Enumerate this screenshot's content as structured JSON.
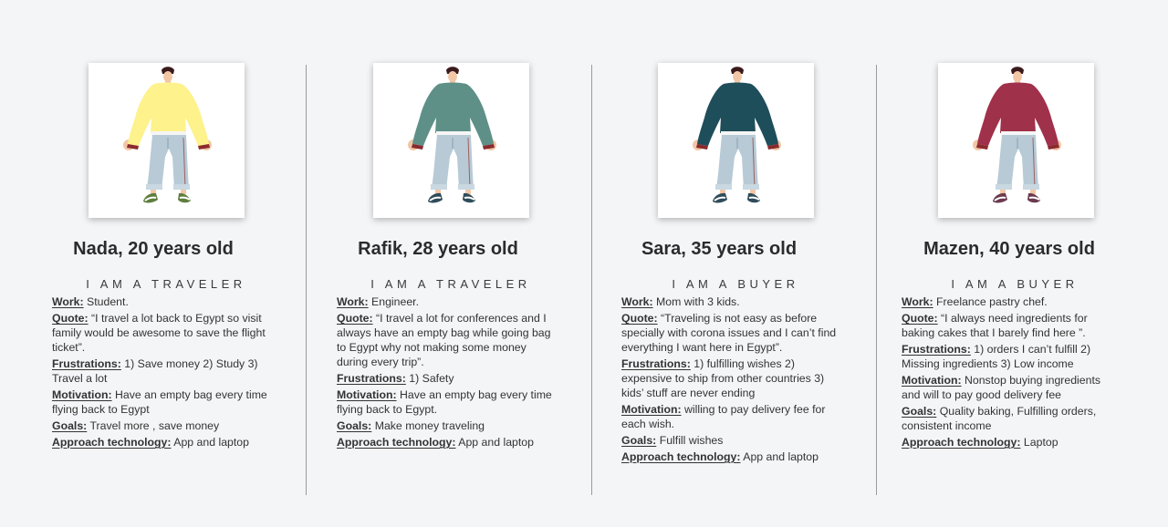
{
  "personas": [
    {
      "name": "Nada, 20 years old",
      "role": "I AM A TRAVELER",
      "shirt_color": "#fdf28b",
      "shoe_color": "#5e7e3e",
      "fields": [
        {
          "label": "Work:",
          "value": "Student."
        },
        {
          "label": "Quote:",
          "value": "“I travel a lot back to Egypt so visit family would be awesome to save the flight ticket”."
        },
        {
          "label": "Frustrations:",
          "value": "1) Save money 2) Study 3) Travel a lot"
        },
        {
          "label": "Motivation:",
          "value": "Have an empty bag every time flying back to Egypt"
        },
        {
          "label": "Goals:",
          "value": "Travel more , save money"
        },
        {
          "label": "Approach technology:",
          "value": "App and laptop"
        }
      ]
    },
    {
      "name": "Rafik, 28 years old",
      "role": "I AM A TRAVELER",
      "shirt_color": "#5e9088",
      "shoe_color": "#2f4c5a",
      "fields": [
        {
          "label": "Work:",
          "value": "Engineer."
        },
        {
          "label": "Quote:",
          "value": "“I travel a lot for conferences and I always have an empty bag while going bag to Egypt why not making some money during every trip”."
        },
        {
          "label": "Frustrations:",
          "value": "1) Safety"
        },
        {
          "label": "Motivation:",
          "value": "Have an empty bag every time flying back to Egypt."
        },
        {
          "label": "Goals:",
          "value": "Make money traveling"
        },
        {
          "label": "Approach technology:",
          "value": "App and laptop"
        }
      ]
    },
    {
      "name": "Sara, 35 years old",
      "role": "I AM A BUYER",
      "shirt_color": "#1f4e5b",
      "shoe_color": "#2f4c5a",
      "fields": [
        {
          "label": "Work:",
          "value": "Mom with 3 kids."
        },
        {
          "label": "Quote:",
          "value": "“Traveling is not easy as before specially with corona issues and I can’t find everything I want here in Egypt”."
        },
        {
          "label": "Frustrations:",
          "value": "1) fulfilling wishes 2) expensive to ship from other countries 3) kids’ stuff are never ending"
        },
        {
          "label": "Motivation:",
          "value": "willing to pay delivery fee for each wish."
        },
        {
          "label": "Goals:",
          "value": "Fulfill wishes"
        },
        {
          "label": "Approach technology:",
          "value": "App and laptop"
        }
      ]
    },
    {
      "name": "Mazen, 40 years old",
      "role": "I AM A BUYER",
      "shirt_color": "#a0314a",
      "shoe_color": "#6b3a4f",
      "fields": [
        {
          "label": "Work:",
          "value": "Freelance pastry chef."
        },
        {
          "label": "Quote:",
          "value": "“I always need ingredients for baking cakes that I barely find here ”."
        },
        {
          "label": "Frustrations:",
          "value": "1) orders I can’t fulfill 2) Missing ingredients 3) Low income"
        },
        {
          "label": "Motivation:",
          "value": "Nonstop buying ingredients and will to pay good delivery fee"
        },
        {
          "label": "Goals:",
          "value": "Quality baking, Fulfilling orders, consistent income"
        },
        {
          "label": "Approach technology:",
          "value": "Laptop"
        }
      ]
    }
  ]
}
